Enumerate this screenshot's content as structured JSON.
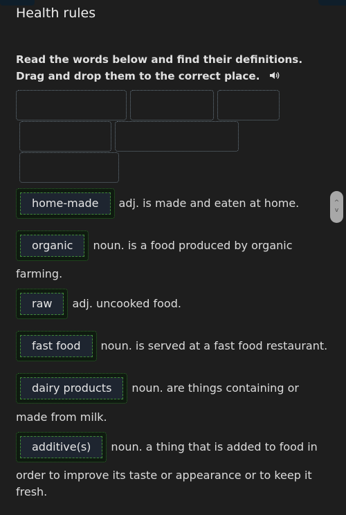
{
  "header": {
    "title": "Health rules",
    "instructions_line1": "Read the words below and find their definitions.",
    "instructions_line2": "Drag and drop them to the correct place.",
    "audio_icon": "speaker-icon"
  },
  "drop_zones_count": 6,
  "items": [
    {
      "word": "home-made",
      "definition": "adj. is made and eaten at home.",
      "continuation": ""
    },
    {
      "word": "organic",
      "definition": "noun. is a food produced by organic",
      "continuation": "farming."
    },
    {
      "word": "raw",
      "definition": "adj. uncooked food.",
      "continuation": ""
    },
    {
      "word": "fast food",
      "definition": "noun. is served at a fast food restaurant.",
      "continuation": ""
    },
    {
      "word": "dairy products",
      "definition": "noun. are things containing or",
      "continuation": "made from milk."
    },
    {
      "word": "additive(s)",
      "definition": "noun. a thing that is added to food in",
      "continuation": "order to improve its taste or appearance or to keep it",
      "continuation2": "fresh."
    }
  ],
  "scroll": {
    "up_icon": "chevron-up-icon",
    "down_icon": "chevron-down-icon",
    "up_glyph": "^",
    "down_glyph": "v"
  },
  "colors": {
    "background": "#1e1e1e",
    "tile_border": "#3f8a38",
    "tile_bg": "#1e2530",
    "drop_border": "#6a7a85"
  }
}
